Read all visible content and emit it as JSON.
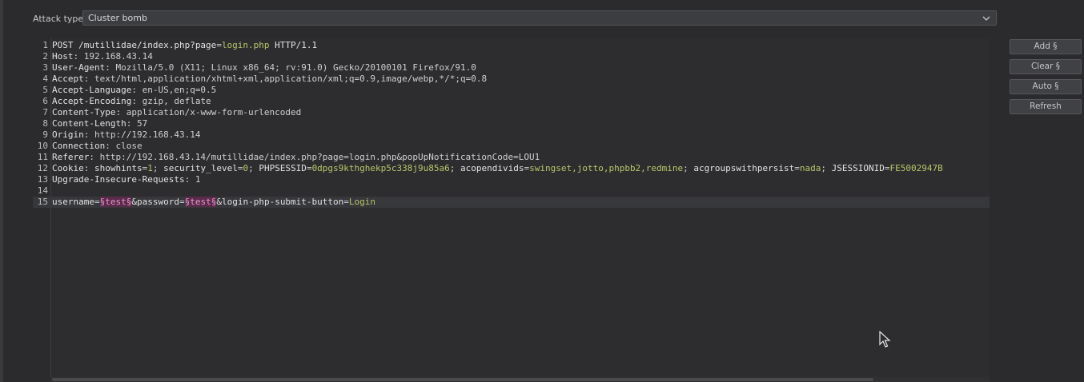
{
  "attack": {
    "label": "Attack type:",
    "value": "Cluster bomb"
  },
  "buttons": {
    "add": "Add §",
    "clear": "Clear §",
    "auto": "Auto §",
    "refresh": "Refresh"
  },
  "request": {
    "lines": [
      {
        "n": "1",
        "segs": [
          [
            "k",
            "POST /mutillidae/index.php?"
          ],
          [
            "k",
            "page"
          ],
          [
            "v",
            "="
          ],
          [
            "g",
            "login.php"
          ],
          [
            "k",
            " HTTP/1.1"
          ]
        ]
      },
      {
        "n": "2",
        "segs": [
          [
            "k",
            "Host"
          ],
          [
            "v",
            ": 192.168.43.14"
          ]
        ]
      },
      {
        "n": "3",
        "segs": [
          [
            "k",
            "User-Agent"
          ],
          [
            "v",
            ": Mozilla/5.0 (X11; Linux x86_64; rv:91.0) Gecko/20100101 Firefox/91.0"
          ]
        ]
      },
      {
        "n": "4",
        "segs": [
          [
            "k",
            "Accept"
          ],
          [
            "v",
            ": text/html,application/xhtml+xml,application/xml;q=0.9,image/webp,*/*;q=0.8"
          ]
        ]
      },
      {
        "n": "5",
        "segs": [
          [
            "k",
            "Accept-Language"
          ],
          [
            "v",
            ": en-US,en;q=0.5"
          ]
        ]
      },
      {
        "n": "6",
        "segs": [
          [
            "k",
            "Accept-Encoding"
          ],
          [
            "v",
            ": gzip, deflate"
          ]
        ]
      },
      {
        "n": "7",
        "segs": [
          [
            "k",
            "Content-Type"
          ],
          [
            "v",
            ": application/x-www-form-urlencoded"
          ]
        ]
      },
      {
        "n": "8",
        "segs": [
          [
            "k",
            "Content-Length"
          ],
          [
            "v",
            ": 57"
          ]
        ]
      },
      {
        "n": "9",
        "segs": [
          [
            "k",
            "Origin"
          ],
          [
            "v",
            ": http://192.168.43.14"
          ]
        ]
      },
      {
        "n": "10",
        "segs": [
          [
            "k",
            "Connection"
          ],
          [
            "v",
            ": close"
          ]
        ]
      },
      {
        "n": "11",
        "segs": [
          [
            "k",
            "Referer"
          ],
          [
            "v",
            ": http://192.168.43.14/mutillidae/index.php?page=login.php&popUpNotificationCode=LOU1"
          ]
        ]
      },
      {
        "n": "12",
        "segs": [
          [
            "k",
            "Cookie"
          ],
          [
            "v",
            ": "
          ],
          [
            "k",
            "showhints"
          ],
          [
            "v",
            "="
          ],
          [
            "g",
            "1"
          ],
          [
            "v",
            "; "
          ],
          [
            "k",
            "security_level"
          ],
          [
            "v",
            "="
          ],
          [
            "g",
            "0"
          ],
          [
            "v",
            "; "
          ],
          [
            "k",
            "PHPSESSID"
          ],
          [
            "v",
            "="
          ],
          [
            "g",
            "0dpgs9kthghekp5c338j9u85a6"
          ],
          [
            "v",
            "; "
          ],
          [
            "k",
            "acopendivids"
          ],
          [
            "v",
            "="
          ],
          [
            "g",
            "swingset,jotto,phpbb2,redmine"
          ],
          [
            "v",
            "; "
          ],
          [
            "k",
            "acgroupswithpersist"
          ],
          [
            "v",
            "="
          ],
          [
            "g",
            "nada"
          ],
          [
            "v",
            "; "
          ],
          [
            "k",
            "JSESSIONID"
          ],
          [
            "v",
            "="
          ],
          [
            "g",
            "FE5002947B"
          ]
        ]
      },
      {
        "n": "13",
        "segs": [
          [
            "k",
            "Upgrade-Insecure-Requests"
          ],
          [
            "v",
            ": 1"
          ]
        ]
      },
      {
        "n": "14",
        "segs": []
      },
      {
        "n": "15",
        "segs": [
          [
            "k",
            "username"
          ],
          [
            "v",
            "="
          ],
          [
            "p",
            "§test§"
          ],
          [
            "k",
            "&password"
          ],
          [
            "v",
            "="
          ],
          [
            "p",
            "§test§"
          ],
          [
            "k",
            "&login-php-submit-button"
          ],
          [
            "v",
            "="
          ],
          [
            "g",
            "Login"
          ]
        ]
      }
    ]
  },
  "icons": {
    "dropdown": "chevron-down-icon",
    "cursor": "mouse-pointer-icon"
  }
}
